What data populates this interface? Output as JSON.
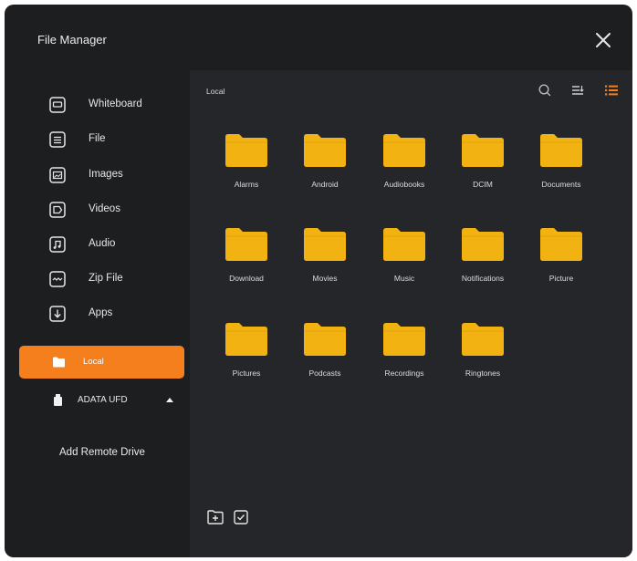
{
  "window": {
    "title": "File Manager"
  },
  "sidebar": {
    "categories": [
      {
        "label": "Whiteboard",
        "icon": "whiteboard-icon"
      },
      {
        "label": "File",
        "icon": "file-icon"
      },
      {
        "label": "Images",
        "icon": "image-icon"
      },
      {
        "label": "Videos",
        "icon": "video-icon"
      },
      {
        "label": "Audio",
        "icon": "audio-icon"
      },
      {
        "label": "Zip File",
        "icon": "zip-file-icon"
      },
      {
        "label": "Apps",
        "icon": "apps-icon"
      }
    ],
    "local_label": "Local",
    "drive_label": "ADATA UFD",
    "remote_label": "Add Remote Drive"
  },
  "main": {
    "path": "Local",
    "folders": [
      "Alarms",
      "Android",
      "Audiobooks",
      "DCIM",
      "Documents",
      "Download",
      "Movies",
      "Music",
      "Notifications",
      "Picture",
      "Pictures",
      "Podcasts",
      "Recordings",
      "Ringtones"
    ]
  },
  "colors": {
    "accent": "#f57e1d",
    "folder": "#f2b312",
    "background": "#1d1e20",
    "panel": "#252629"
  }
}
